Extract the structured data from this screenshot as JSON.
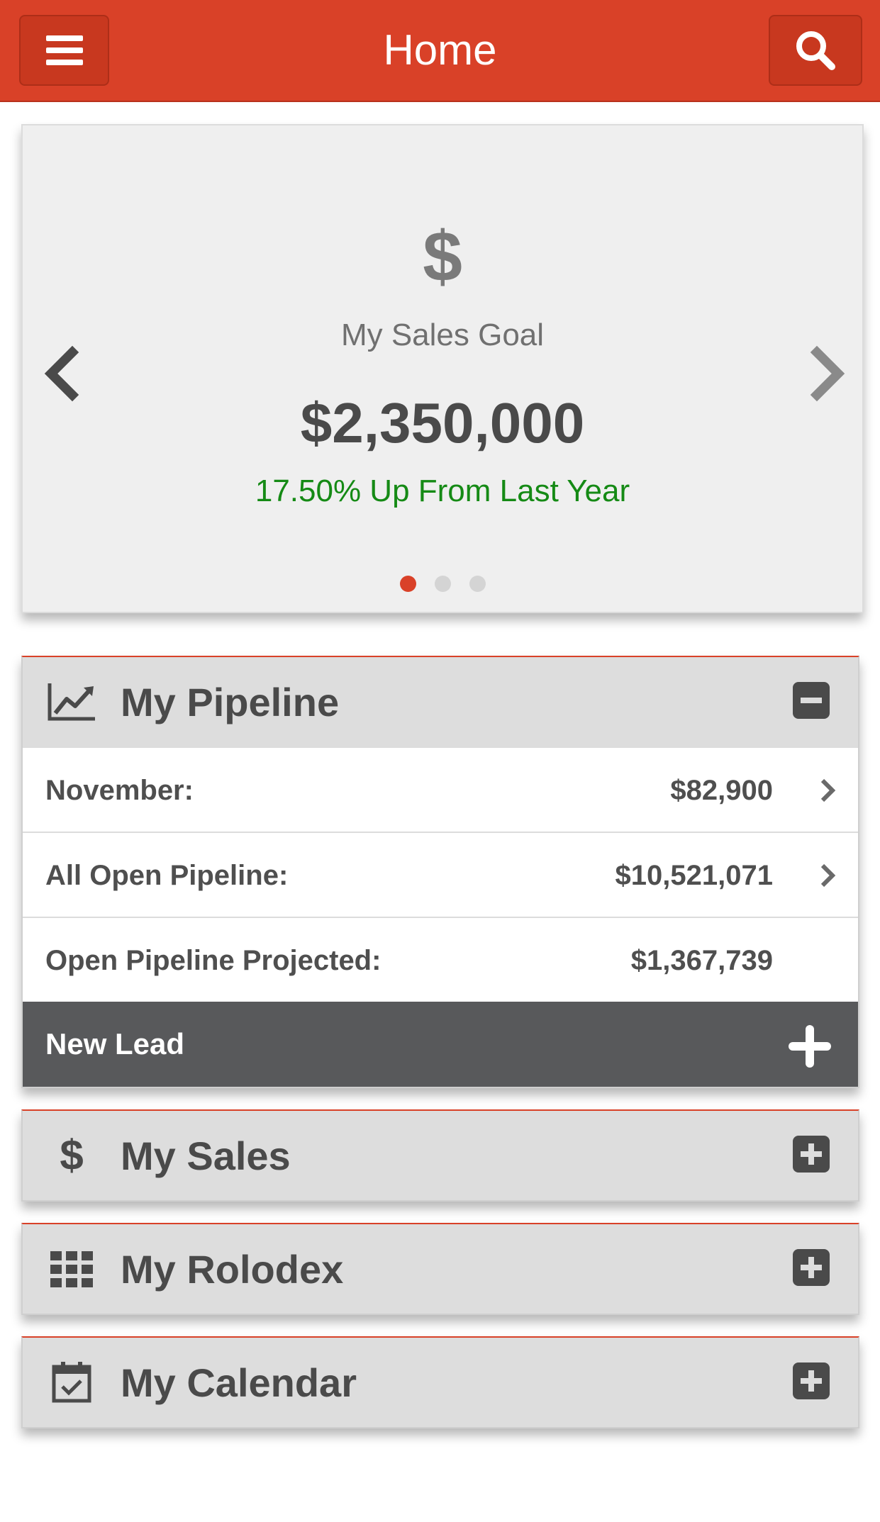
{
  "header": {
    "title": "Home",
    "menu_icon": "hamburger-menu-icon",
    "search_icon": "search-icon",
    "color": "#d94128"
  },
  "carousel": {
    "icon": "dollar-icon",
    "icon_glyph": "$",
    "label": "My Sales Goal",
    "value": "$2,350,000",
    "change": "17.50% Up From Last Year",
    "change_color": "#158a15",
    "slides": 3,
    "active_slide": 1
  },
  "pipeline": {
    "title": "My Pipeline",
    "icon": "line-chart-icon",
    "expanded": true,
    "rows": [
      {
        "label": "November:",
        "value": "$82,900",
        "has_chevron": true
      },
      {
        "label": "All Open Pipeline:",
        "value": "$10,521,071",
        "has_chevron": true
      },
      {
        "label": "Open Pipeline Projected:",
        "value": "$1,367,739",
        "has_chevron": false
      }
    ],
    "new_lead_label": "New Lead"
  },
  "sections": [
    {
      "title": "My Sales",
      "icon": "dollar-icon",
      "icon_glyph": "$",
      "expanded": false
    },
    {
      "title": "My Rolodex",
      "icon": "grid-icon",
      "expanded": false
    },
    {
      "title": "My Calendar",
      "icon": "calendar-icon",
      "expanded": false
    }
  ]
}
